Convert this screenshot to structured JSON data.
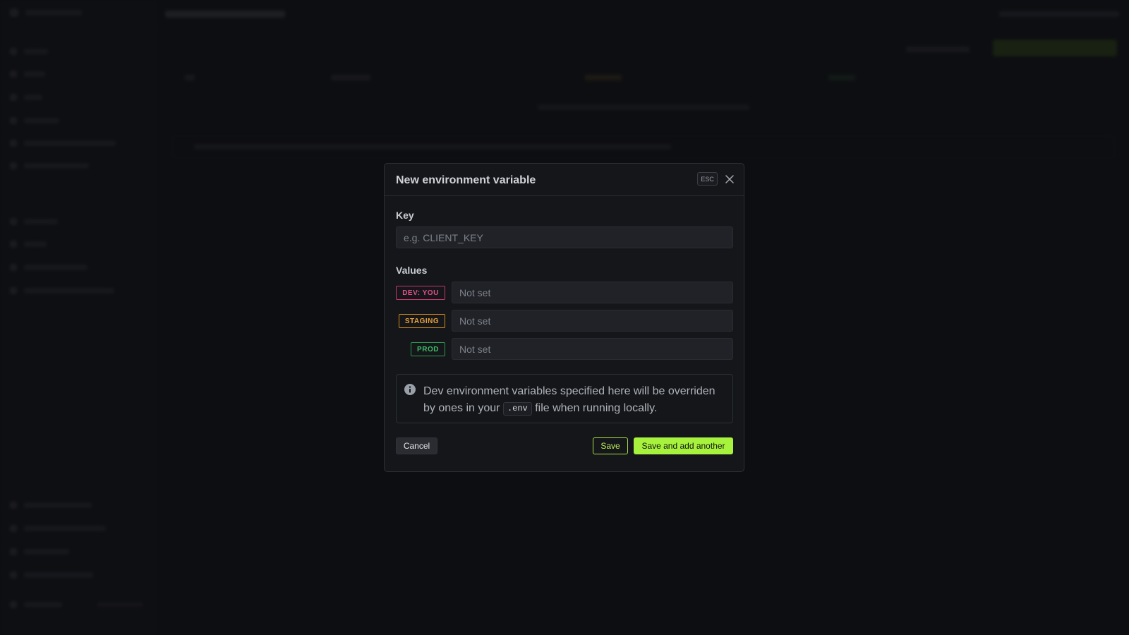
{
  "modal": {
    "title": "New environment variable",
    "esc_label": "ESC",
    "key_label": "Key",
    "key_placeholder": "e.g. CLIENT_KEY",
    "key_value": "",
    "values_label": "Values",
    "environments": [
      {
        "badge": "DEV: YOU",
        "placeholder": "Not set",
        "value": ""
      },
      {
        "badge": "STAGING",
        "placeholder": "Not set",
        "value": ""
      },
      {
        "badge": "PROD",
        "placeholder": "Not set",
        "value": ""
      }
    ],
    "info": {
      "text_before": "Dev environment variables specified here will be overriden by ones in your ",
      "code": ".env",
      "text_after": " file when running locally."
    },
    "cancel_label": "Cancel",
    "save_label": "Save",
    "save_another_label": "Save and add another"
  },
  "colors": {
    "accent_green": "#a6f23c",
    "dev_badge": "#e0508a",
    "staging_badge": "#e8a23a",
    "prod_badge": "#3fbf67"
  },
  "icons": {
    "close": "close-icon",
    "info": "info-icon"
  }
}
